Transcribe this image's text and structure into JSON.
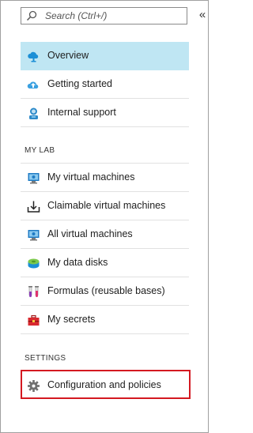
{
  "search": {
    "placeholder": "Search (Ctrl+/)"
  },
  "collapse": {
    "label": "«"
  },
  "top_items": [
    {
      "label": "Overview",
      "icon": "cloud-overview-icon",
      "selected": true
    },
    {
      "label": "Getting started",
      "icon": "cloud-start-icon"
    },
    {
      "label": "Internal support",
      "icon": "support-person-icon"
    }
  ],
  "my_lab": {
    "header": "MY LAB",
    "items": [
      {
        "label": "My virtual machines",
        "icon": "vm-icon"
      },
      {
        "label": "Claimable virtual machines",
        "icon": "download-tray-icon"
      },
      {
        "label": "All virtual machines",
        "icon": "vm-icon"
      },
      {
        "label": "My data disks",
        "icon": "disk-icon"
      },
      {
        "label": "Formulas (reusable bases)",
        "icon": "test-tubes-icon"
      },
      {
        "label": "My secrets",
        "icon": "toolbox-icon"
      }
    ]
  },
  "settings": {
    "header": "SETTINGS",
    "items": [
      {
        "label": "Configuration and policies",
        "icon": "gear-icon",
        "highlighted": true
      }
    ]
  },
  "colors": {
    "selected_bg": "#bfe6f3",
    "highlight_border": "#d41921",
    "accent_blue": "#1c8fd6"
  }
}
